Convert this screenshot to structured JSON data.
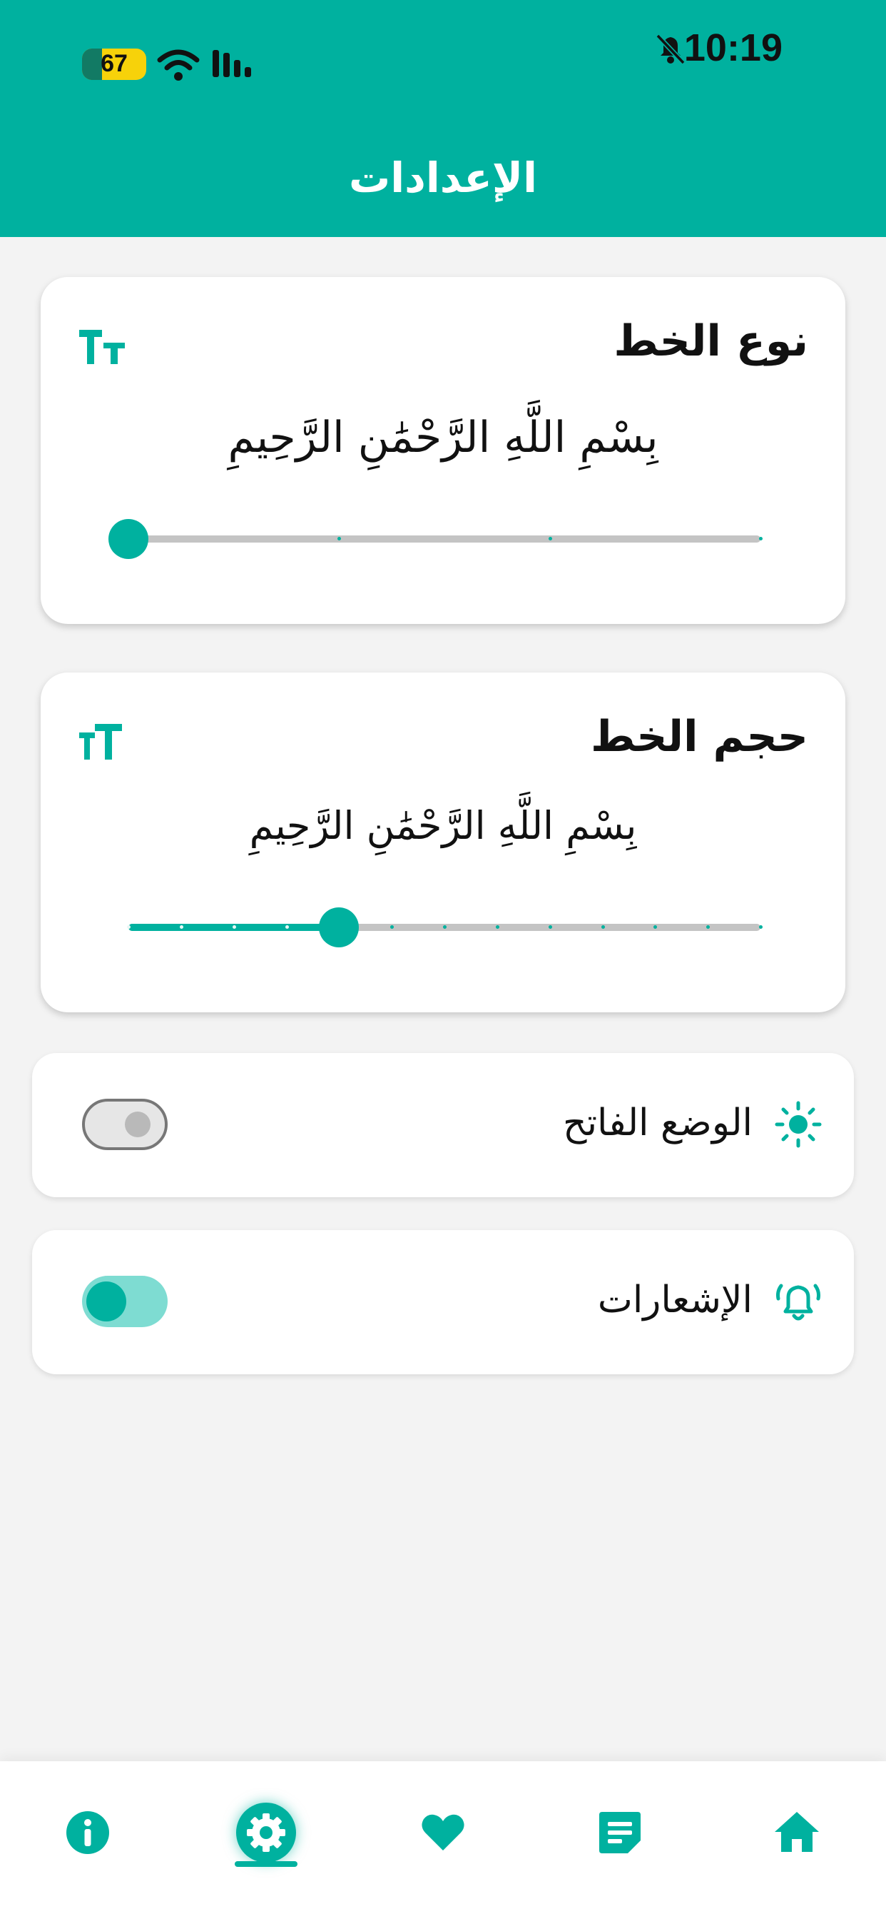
{
  "status_bar": {
    "time": "10:19",
    "battery": "67"
  },
  "header": {
    "title": "الإعدادات"
  },
  "font_type_card": {
    "title": "نوع الخط",
    "sample": "بِسْمِ اللَّهِ الرَّحْمَٰنِ الرَّحِيمِ",
    "icon": "text-format-icon",
    "slider": {
      "value": 0,
      "steps": 3
    }
  },
  "font_size_card": {
    "title": "حجم الخط",
    "sample": "بِسْمِ اللَّهِ الرَّحْمَٰنِ الرَّحِيمِ",
    "icon": "text-size-icon",
    "slider": {
      "value": 4,
      "steps": 12
    }
  },
  "light_mode": {
    "label": "الوضع الفاتح",
    "icon": "sun-icon",
    "enabled": false
  },
  "notifications": {
    "label": "الإشعارات",
    "icon": "bell-ring-icon",
    "enabled": true
  },
  "bottom_nav": {
    "items": [
      "info-icon",
      "settings-icon",
      "heart-icon",
      "notes-icon",
      "home-icon"
    ],
    "active": "settings-icon"
  },
  "colors": {
    "accent": "#00b19f",
    "track": "#c4c4c4",
    "background": "#f3f3f3"
  }
}
